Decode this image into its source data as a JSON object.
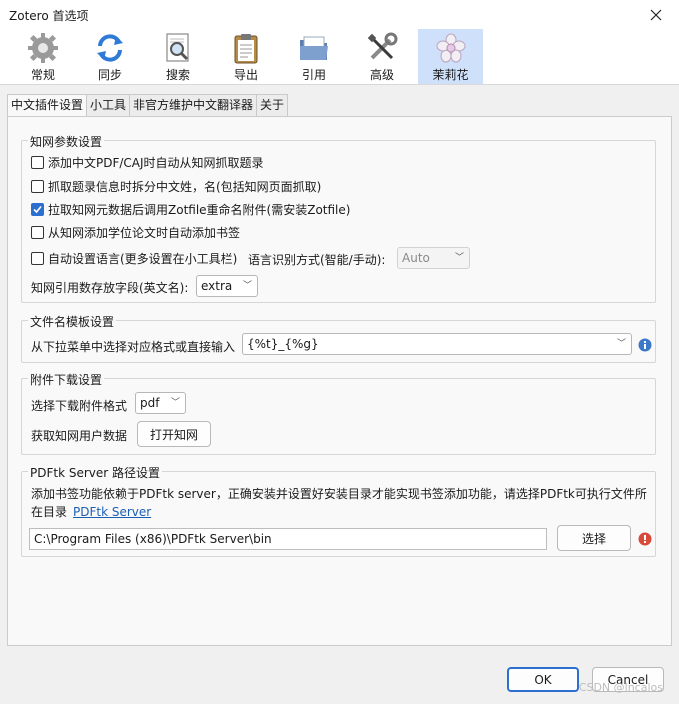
{
  "window": {
    "title": "Zotero 首选项"
  },
  "toolbar": {
    "items": [
      {
        "label": "常规",
        "icon": "gear-icon"
      },
      {
        "label": "同步",
        "icon": "sync-icon"
      },
      {
        "label": "搜索",
        "icon": "search-icon"
      },
      {
        "label": "导出",
        "icon": "clipboard-icon"
      },
      {
        "label": "引用",
        "icon": "folder-icon"
      },
      {
        "label": "高级",
        "icon": "tools-icon"
      },
      {
        "label": "茉莉花",
        "icon": "jasmine-flower-icon"
      }
    ],
    "active": "茉莉花"
  },
  "tabs": [
    "中文插件设置",
    "小工具",
    "非官方维护中文翻译器",
    "关于"
  ],
  "cnki": {
    "legend": "知网参数设置",
    "options": [
      {
        "label": "添加中文PDF/CAJ时自动从知网抓取题录",
        "checked": false
      },
      {
        "label": "抓取题录信息时拆分中文姓，名(包括知网页面抓取)",
        "checked": false
      },
      {
        "label": "拉取知网元数据后调用Zotfile重命名附件(需安装Zotfile)",
        "checked": true
      },
      {
        "label": "从知网添加学位论文时自动添加书签",
        "checked": false
      },
      {
        "label": "自动设置语言(更多设置在小工具栏)",
        "checked": false
      }
    ],
    "lang_mode_label": "语言识别方式(智能/手动):",
    "lang_mode_value": "Auto",
    "cite_field_label": "知网引用数存放字段(英文名):",
    "cite_field_value": "extra"
  },
  "filename": {
    "legend": "文件名模板设置",
    "label": "从下拉菜单中选择对应格式或直接输入",
    "value": "{%t}_{%g}"
  },
  "download": {
    "legend": "附件下载设置",
    "format_label": "选择下载附件格式",
    "format_value": "pdf",
    "user_label": "获取知网用户数据",
    "open_button": "打开知网"
  },
  "pdftk": {
    "legend": "PDFtk Server 路径设置",
    "desc1": "添加书签功能依赖于PDFtk server，正确安装并设置好安装目录才能实现书签添加功能，请选择PDFtk可执行文件所",
    "desc2": "在目录",
    "link": "PDFtk Server",
    "path_value": "C:\\Program Files (x86)\\PDFtk Server\\bin",
    "choose_button": "选择"
  },
  "footer": {
    "ok": "OK",
    "cancel": "Cancel"
  },
  "watermark": "CSDN @lncalos",
  "colors": {
    "accent": "#2d6fcf",
    "active_tab": "#cfe0fb",
    "link": "#1b5fb5",
    "error": "#d84a3a",
    "info": "#3a78c9"
  }
}
